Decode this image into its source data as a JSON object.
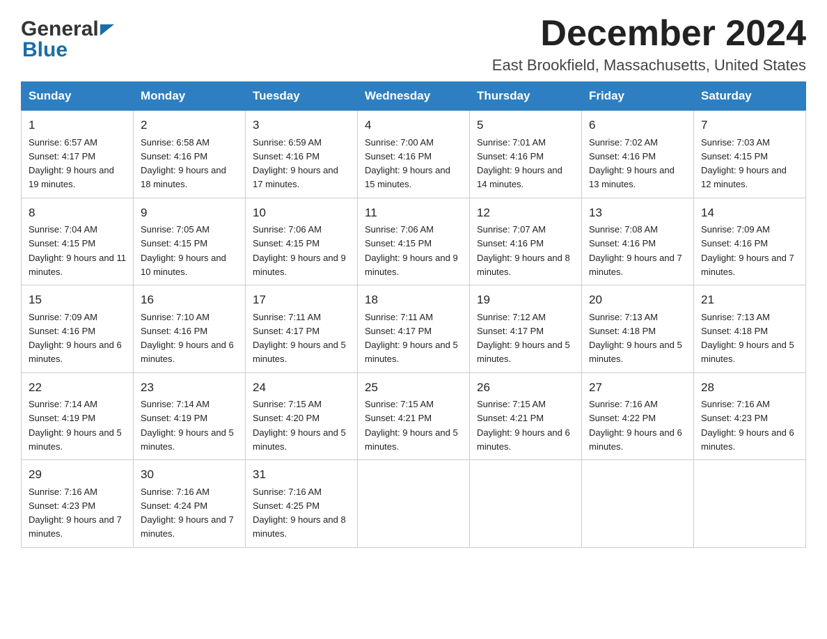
{
  "header": {
    "logo_general": "General",
    "logo_blue": "Blue",
    "month_title": "December 2024",
    "location": "East Brookfield, Massachusetts, United States"
  },
  "days_of_week": [
    "Sunday",
    "Monday",
    "Tuesday",
    "Wednesday",
    "Thursday",
    "Friday",
    "Saturday"
  ],
  "weeks": [
    [
      {
        "day": "1",
        "sunrise": "6:57 AM",
        "sunset": "4:17 PM",
        "daylight": "9 hours and 19 minutes."
      },
      {
        "day": "2",
        "sunrise": "6:58 AM",
        "sunset": "4:16 PM",
        "daylight": "9 hours and 18 minutes."
      },
      {
        "day": "3",
        "sunrise": "6:59 AM",
        "sunset": "4:16 PM",
        "daylight": "9 hours and 17 minutes."
      },
      {
        "day": "4",
        "sunrise": "7:00 AM",
        "sunset": "4:16 PM",
        "daylight": "9 hours and 15 minutes."
      },
      {
        "day": "5",
        "sunrise": "7:01 AM",
        "sunset": "4:16 PM",
        "daylight": "9 hours and 14 minutes."
      },
      {
        "day": "6",
        "sunrise": "7:02 AM",
        "sunset": "4:16 PM",
        "daylight": "9 hours and 13 minutes."
      },
      {
        "day": "7",
        "sunrise": "7:03 AM",
        "sunset": "4:15 PM",
        "daylight": "9 hours and 12 minutes."
      }
    ],
    [
      {
        "day": "8",
        "sunrise": "7:04 AM",
        "sunset": "4:15 PM",
        "daylight": "9 hours and 11 minutes."
      },
      {
        "day": "9",
        "sunrise": "7:05 AM",
        "sunset": "4:15 PM",
        "daylight": "9 hours and 10 minutes."
      },
      {
        "day": "10",
        "sunrise": "7:06 AM",
        "sunset": "4:15 PM",
        "daylight": "9 hours and 9 minutes."
      },
      {
        "day": "11",
        "sunrise": "7:06 AM",
        "sunset": "4:15 PM",
        "daylight": "9 hours and 9 minutes."
      },
      {
        "day": "12",
        "sunrise": "7:07 AM",
        "sunset": "4:16 PM",
        "daylight": "9 hours and 8 minutes."
      },
      {
        "day": "13",
        "sunrise": "7:08 AM",
        "sunset": "4:16 PM",
        "daylight": "9 hours and 7 minutes."
      },
      {
        "day": "14",
        "sunrise": "7:09 AM",
        "sunset": "4:16 PM",
        "daylight": "9 hours and 7 minutes."
      }
    ],
    [
      {
        "day": "15",
        "sunrise": "7:09 AM",
        "sunset": "4:16 PM",
        "daylight": "9 hours and 6 minutes."
      },
      {
        "day": "16",
        "sunrise": "7:10 AM",
        "sunset": "4:16 PM",
        "daylight": "9 hours and 6 minutes."
      },
      {
        "day": "17",
        "sunrise": "7:11 AM",
        "sunset": "4:17 PM",
        "daylight": "9 hours and 5 minutes."
      },
      {
        "day": "18",
        "sunrise": "7:11 AM",
        "sunset": "4:17 PM",
        "daylight": "9 hours and 5 minutes."
      },
      {
        "day": "19",
        "sunrise": "7:12 AM",
        "sunset": "4:17 PM",
        "daylight": "9 hours and 5 minutes."
      },
      {
        "day": "20",
        "sunrise": "7:13 AM",
        "sunset": "4:18 PM",
        "daylight": "9 hours and 5 minutes."
      },
      {
        "day": "21",
        "sunrise": "7:13 AM",
        "sunset": "4:18 PM",
        "daylight": "9 hours and 5 minutes."
      }
    ],
    [
      {
        "day": "22",
        "sunrise": "7:14 AM",
        "sunset": "4:19 PM",
        "daylight": "9 hours and 5 minutes."
      },
      {
        "day": "23",
        "sunrise": "7:14 AM",
        "sunset": "4:19 PM",
        "daylight": "9 hours and 5 minutes."
      },
      {
        "day": "24",
        "sunrise": "7:15 AM",
        "sunset": "4:20 PM",
        "daylight": "9 hours and 5 minutes."
      },
      {
        "day": "25",
        "sunrise": "7:15 AM",
        "sunset": "4:21 PM",
        "daylight": "9 hours and 5 minutes."
      },
      {
        "day": "26",
        "sunrise": "7:15 AM",
        "sunset": "4:21 PM",
        "daylight": "9 hours and 6 minutes."
      },
      {
        "day": "27",
        "sunrise": "7:16 AM",
        "sunset": "4:22 PM",
        "daylight": "9 hours and 6 minutes."
      },
      {
        "day": "28",
        "sunrise": "7:16 AM",
        "sunset": "4:23 PM",
        "daylight": "9 hours and 6 minutes."
      }
    ],
    [
      {
        "day": "29",
        "sunrise": "7:16 AM",
        "sunset": "4:23 PM",
        "daylight": "9 hours and 7 minutes."
      },
      {
        "day": "30",
        "sunrise": "7:16 AM",
        "sunset": "4:24 PM",
        "daylight": "9 hours and 7 minutes."
      },
      {
        "day": "31",
        "sunrise": "7:16 AM",
        "sunset": "4:25 PM",
        "daylight": "9 hours and 8 minutes."
      },
      null,
      null,
      null,
      null
    ]
  ]
}
